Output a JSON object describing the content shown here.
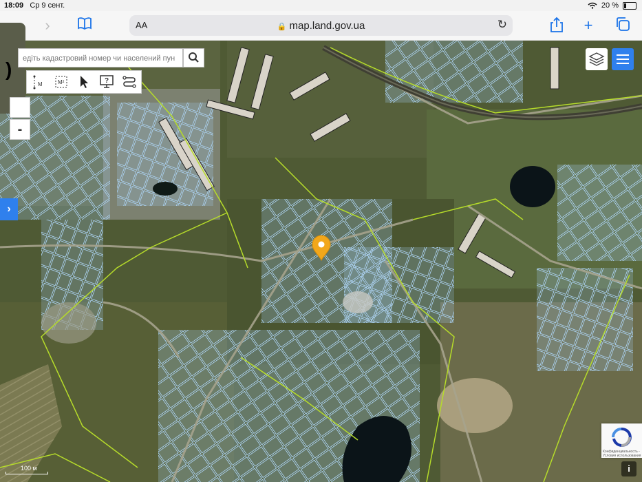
{
  "status_bar": {
    "time": "18:09",
    "date": "Ср 9 сент.",
    "battery": "20 %"
  },
  "browser": {
    "url": "map.land.gov.ua",
    "text_size_label": "AA"
  },
  "map": {
    "search_placeholder": "едіть кадастровий номер чи населений пун",
    "zoom_out_label": "-",
    "scale_label": "100 м",
    "info_label": "i",
    "recaptcha_text": "Конфиденциальность - Условия использования",
    "tools": [
      {
        "name": "measure-distance-tool",
        "label": "М"
      },
      {
        "name": "measure-area-tool",
        "label": "М²"
      },
      {
        "name": "select-pointer-tool",
        "label": ""
      },
      {
        "name": "help-query-tool",
        "label": "?"
      },
      {
        "name": "route-tool",
        "label": ""
      }
    ]
  },
  "colors": {
    "accent": "#2f80ed",
    "parcel": "#9ec6e8",
    "boundary": "#b6dc2a",
    "marker": "#f2a71b"
  },
  "icons": [
    "back-icon",
    "forward-icon",
    "bookmarks-icon",
    "lock-icon",
    "reload-icon",
    "share-icon",
    "add-tab-icon",
    "tabs-icon",
    "search-icon",
    "layers-icon",
    "menu-icon",
    "location-marker-icon",
    "chevron-right-icon",
    "wifi-icon",
    "battery-icon"
  ]
}
